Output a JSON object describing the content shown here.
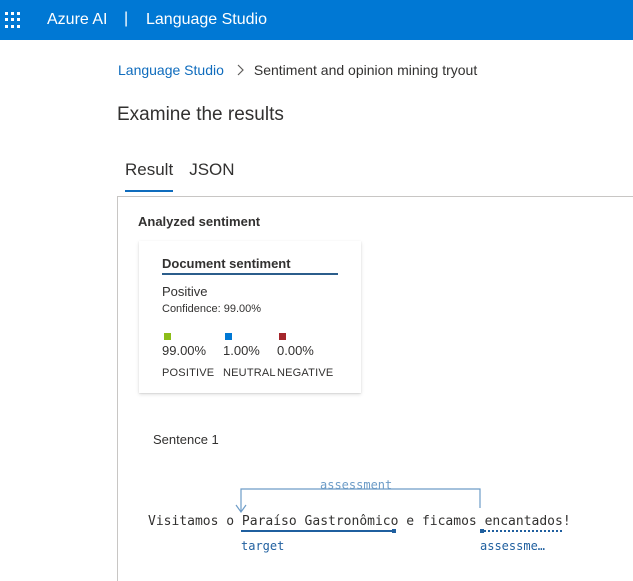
{
  "header": {
    "brand": "Azure AI",
    "separator": "|",
    "product": "Language Studio",
    "waffle_icon": "waffle-icon"
  },
  "breadcrumb": {
    "home": "Language Studio",
    "chevron_icon": "chevron-right-icon",
    "current": "Sentiment and opinion mining tryout"
  },
  "page": {
    "title": "Examine the results"
  },
  "tabs": [
    {
      "label": "Result",
      "active": true
    },
    {
      "label": "JSON",
      "active": false
    }
  ],
  "results": {
    "analyzed_title": "Analyzed sentiment",
    "document_card": {
      "title": "Document sentiment",
      "sentiment": "Positive",
      "confidence": "Confidence: 99.00%",
      "scores": [
        {
          "label": "POSITIVE",
          "value": "99.00%",
          "color": "#8cbd18"
        },
        {
          "label": "NEUTRAL",
          "value": "1.00%",
          "color": "#0078d4"
        },
        {
          "label": "NEGATIVE",
          "value": "0.00%",
          "color": "#a4262c"
        }
      ]
    },
    "sentence": {
      "label": "Sentence 1",
      "parts": {
        "before": "Visitamos o ",
        "target": "Paraíso Gastronômico",
        "middle": " e ficamos ",
        "assessment": "encantados",
        "after": "!"
      },
      "relation_label": "assessment",
      "target_label": "target",
      "assessment_label": "assessme…"
    }
  },
  "colors": {
    "topbar": "#0078d4",
    "link": "#0f6cbd",
    "relation": "#6d9cc7",
    "annotation": "#1f5f9f"
  }
}
